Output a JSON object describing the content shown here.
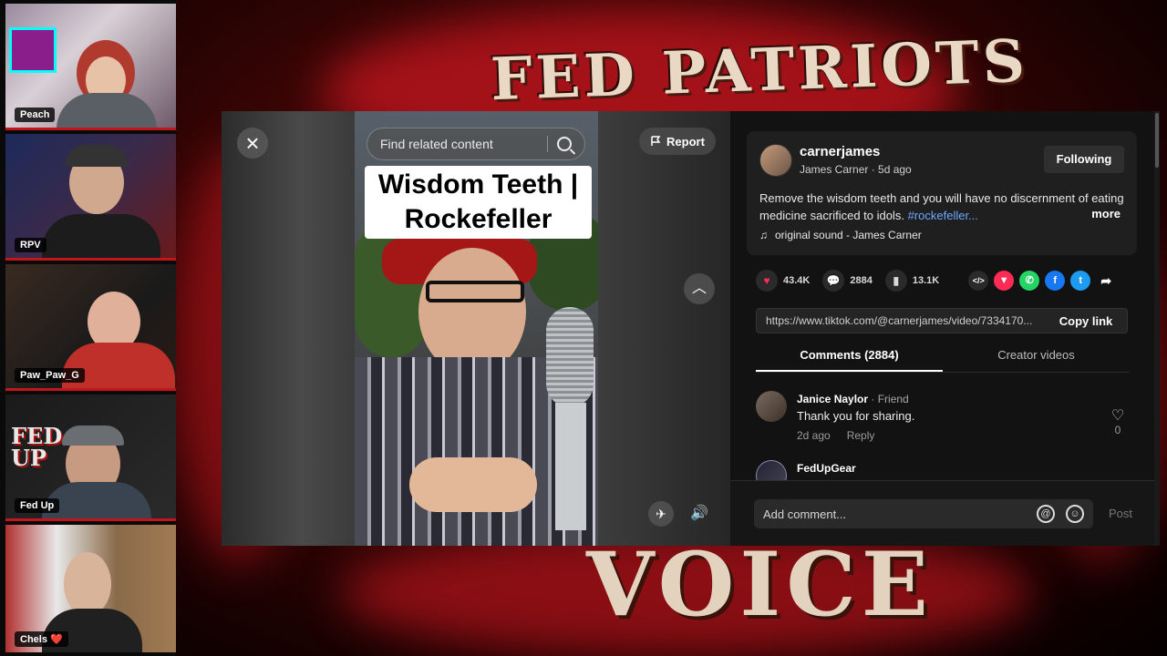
{
  "participants": [
    {
      "name": "Peach"
    },
    {
      "name": "RPV"
    },
    {
      "name": "Paw_Paw_G"
    },
    {
      "name": "Fed Up"
    },
    {
      "name": "Chels ❤️"
    }
  ],
  "background": {
    "title_top": "FED PATRIOTS",
    "title_bottom": "VOICE"
  },
  "video": {
    "search_placeholder": "Find related content",
    "report_label": "Report",
    "caption_line1": "Wisdom Teeth |",
    "caption_line2": "Rockefeller",
    "close_icon": "×",
    "up_icon": "︿",
    "pin_icon": "✈",
    "volume_icon": "🔊"
  },
  "post": {
    "username": "carnerjames",
    "display_name": "James Carner",
    "time_ago": "5d ago",
    "follow_label": "Following",
    "description": "Remove the wisdom teeth and you will have no discernment of eating medicine sacrificed to idols. ",
    "hashtag": "#rockefeller...",
    "more_label": "more",
    "sound": "original sound - James Carner",
    "likes": "43.4K",
    "comments": "2884",
    "saves": "13.1K",
    "link": "https://www.tiktok.com/@carnerjames/video/7334170...",
    "copy_label": "Copy link"
  },
  "tabs": [
    {
      "label": "Comments (2884)"
    },
    {
      "label": "Creator videos"
    }
  ],
  "comments": [
    {
      "name": "Janice Naylor",
      "relation": "· Friend",
      "text": "Thank you for sharing.",
      "time": "2d ago",
      "reply": "Reply",
      "likes": "0"
    },
    {
      "name": "FedUpGear",
      "relation": "",
      "text": "",
      "time": "",
      "reply": "",
      "likes": ""
    }
  ],
  "comment_box": {
    "placeholder": "Add comment...",
    "post_label": "Post"
  },
  "colors": {
    "accent_red": "#c0161c",
    "like_red": "#fe2c55",
    "hashtag_blue": "#6ea8ff"
  }
}
